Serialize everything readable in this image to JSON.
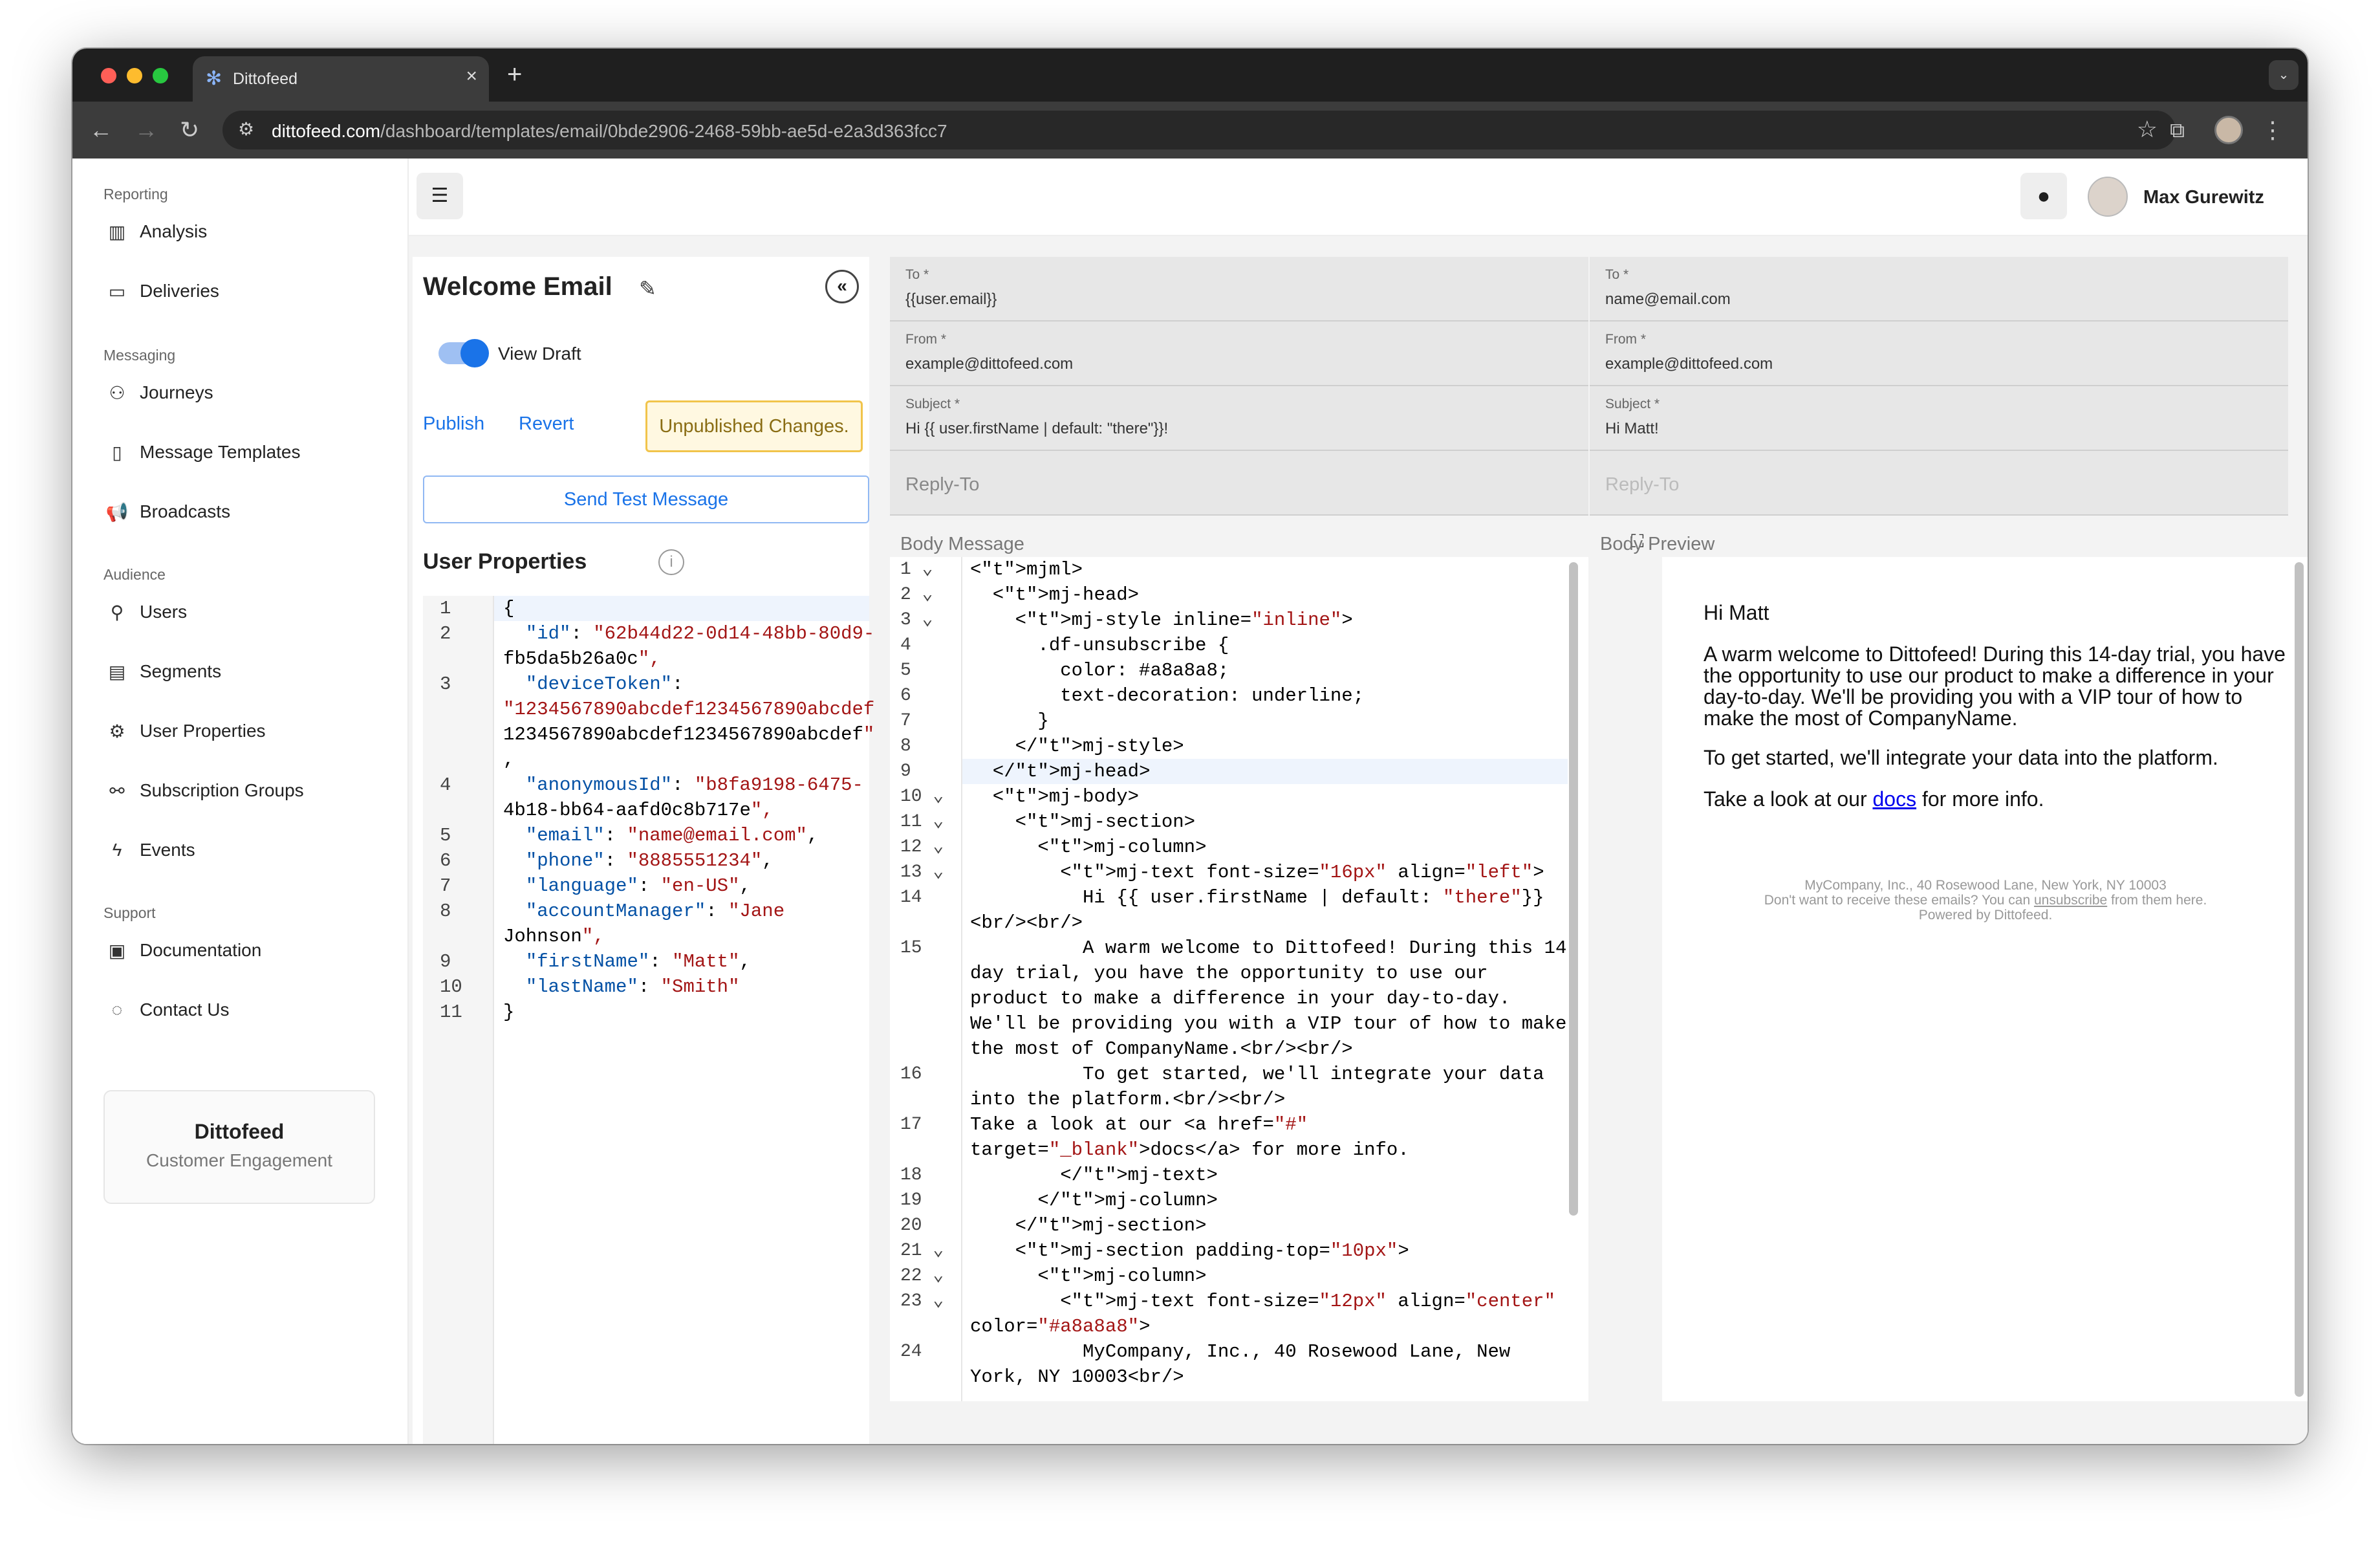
{
  "browser": {
    "tab_title": "Dittofeed",
    "url_domain": "dittofeed.com",
    "url_path": "/dashboard/templates/email/0bde2906-2468-59bb-ae5d-e2a3d363fcc7"
  },
  "sidebar": {
    "sections": [
      {
        "title": "Reporting",
        "items": [
          {
            "label": "Analysis",
            "icon": "bar-chart-icon"
          },
          {
            "label": "Deliveries",
            "icon": "inbox-icon"
          }
        ]
      },
      {
        "title": "Messaging",
        "items": [
          {
            "label": "Journeys",
            "icon": "journey-icon"
          },
          {
            "label": "Message Templates",
            "icon": "template-icon"
          },
          {
            "label": "Broadcasts",
            "icon": "megaphone-icon"
          }
        ]
      },
      {
        "title": "Audience",
        "items": [
          {
            "label": "Users",
            "icon": "user-icon"
          },
          {
            "label": "Segments",
            "icon": "segment-icon"
          },
          {
            "label": "User Properties",
            "icon": "user-properties-icon"
          },
          {
            "label": "Subscription Groups",
            "icon": "group-icon"
          },
          {
            "label": "Events",
            "icon": "bolt-icon"
          }
        ]
      },
      {
        "title": "Support",
        "items": [
          {
            "label": "Documentation",
            "icon": "book-icon"
          },
          {
            "label": "Contact Us",
            "icon": "chat-icon"
          }
        ]
      }
    ],
    "brand": {
      "name": "Dittofeed",
      "tagline": "Customer Engagement"
    }
  },
  "header": {
    "user_name": "Max Gurewitz"
  },
  "template": {
    "title": "Welcome Email",
    "view_draft_label": "View Draft",
    "view_draft_on": true,
    "publish_label": "Publish",
    "revert_label": "Revert",
    "unpublished_label": "Unpublished Changes.",
    "send_test_label": "Send Test Message",
    "user_properties_title": "User Properties"
  },
  "user_properties_code": {
    "gutter": [
      "1",
      "2",
      "",
      "3",
      "",
      "",
      "",
      "4",
      "",
      "5",
      "6",
      "7",
      "8",
      "",
      "9",
      "10",
      "11"
    ],
    "lines": [
      "{",
      "  \"id\": \"62b44d22-0d14-48bb-80d9-",
      "fb5da5b26a0c\",",
      "  \"deviceToken\":",
      "\"1234567890abcdef1234567890abcdef",
      "1234567890abcdef1234567890abcdef\"",
      ",",
      "  \"anonymousId\": \"b8fa9198-6475-",
      "4b18-bb64-aafd0c8b717e\",",
      "  \"email\": \"name@email.com\",",
      "  \"phone\": \"8885551234\",",
      "  \"language\": \"en-US\",",
      "  \"accountManager\": \"Jane",
      "Johnson\",",
      "  \"firstName\": \"Matt\",",
      "  \"lastName\": \"Smith\"",
      "}"
    ]
  },
  "email_fields": {
    "left": {
      "to_label": "To *",
      "to_value": "{{user.email}}",
      "from_label": "From *",
      "from_value": "example@dittofeed.com",
      "subject_label": "Subject *",
      "subject_value": "Hi {{ user.firstName | default: \"there\"}}!",
      "reply_to_placeholder": "Reply-To"
    },
    "right": {
      "to_label": "To *",
      "to_value": "name@email.com",
      "from_label": "From *",
      "from_value": "example@dittofeed.com",
      "subject_label": "Subject *",
      "subject_value": "Hi Matt!",
      "reply_to_placeholder": "Reply-To"
    }
  },
  "body_message_label": "Body Message",
  "body_preview_label": "Body Preview",
  "body_code": {
    "gutter": [
      "1 ⌄",
      "2 ⌄",
      "3 ⌄",
      "4",
      "5",
      "6",
      "7",
      "8",
      "9",
      "10 ⌄",
      "11 ⌄",
      "12 ⌄",
      "13 ⌄",
      "14",
      "",
      "15",
      "",
      "",
      "",
      "",
      "16",
      "",
      "17",
      "",
      "18",
      "19",
      "20",
      "21 ⌄",
      "22 ⌄",
      "23 ⌄",
      "",
      "24",
      ""
    ],
    "lines": [
      "<mjml>",
      "  <mj-head>",
      "    <mj-style inline=\"inline\">",
      "      .df-unsubscribe {",
      "        color: #a8a8a8;",
      "        text-decoration: underline;",
      "      }",
      "    </mj-style>",
      "  </mj-head>",
      "  <mj-body>",
      "    <mj-section>",
      "      <mj-column>",
      "        <mj-text font-size=\"16px\" align=\"left\">",
      "          Hi {{ user.firstName | default: \"there\"}}",
      "<br/><br/>",
      "          A warm welcome to Dittofeed! During this 14-",
      "day trial, you have the opportunity to use our",
      "product to make a difference in your day-to-day.",
      "We'll be providing you with a VIP tour of how to make",
      "the most of CompanyName.<br/><br/>",
      "          To get started, we'll integrate your data",
      "into the platform.<br/><br/>",
      "Take a look at our <a href=\"#\"",
      "target=\"_blank\">docs</a> for more info.",
      "        </mj-text>",
      "      </mj-column>",
      "    </mj-section>",
      "    <mj-section padding-top=\"10px\">",
      "      <mj-column>",
      "        <mj-text font-size=\"12px\" align=\"center\"",
      "color=\"#a8a8a8\">",
      "          MyCompany, Inc., 40 Rosewood Lane, New",
      "York, NY 10003<br/>"
    ]
  },
  "preview": {
    "greeting": "Hi Matt",
    "para1": "A warm welcome to Dittofeed! During this 14-day trial, you have the opportunity to use our product to make a difference in your day-to-day. We'll be providing you with a VIP tour of how to make the most of CompanyName.",
    "para2": "To get started, we'll integrate your data into the platform.",
    "para3_before": "Take a look at our ",
    "para3_link": "docs",
    "para3_after": " for more info.",
    "footer1": "MyCompany, Inc., 40 Rosewood Lane, New York, NY 10003",
    "footer2_before": "Don't want to receive these emails? You can ",
    "footer2_link": "unsubscribe",
    "footer2_after": " from them here.",
    "footer3": "Powered by Dittofeed."
  },
  "colors": {
    "accent": "#1a73e8",
    "warning_border": "#f1c44b",
    "code_tag": "#116329",
    "code_string": "#a31515"
  }
}
